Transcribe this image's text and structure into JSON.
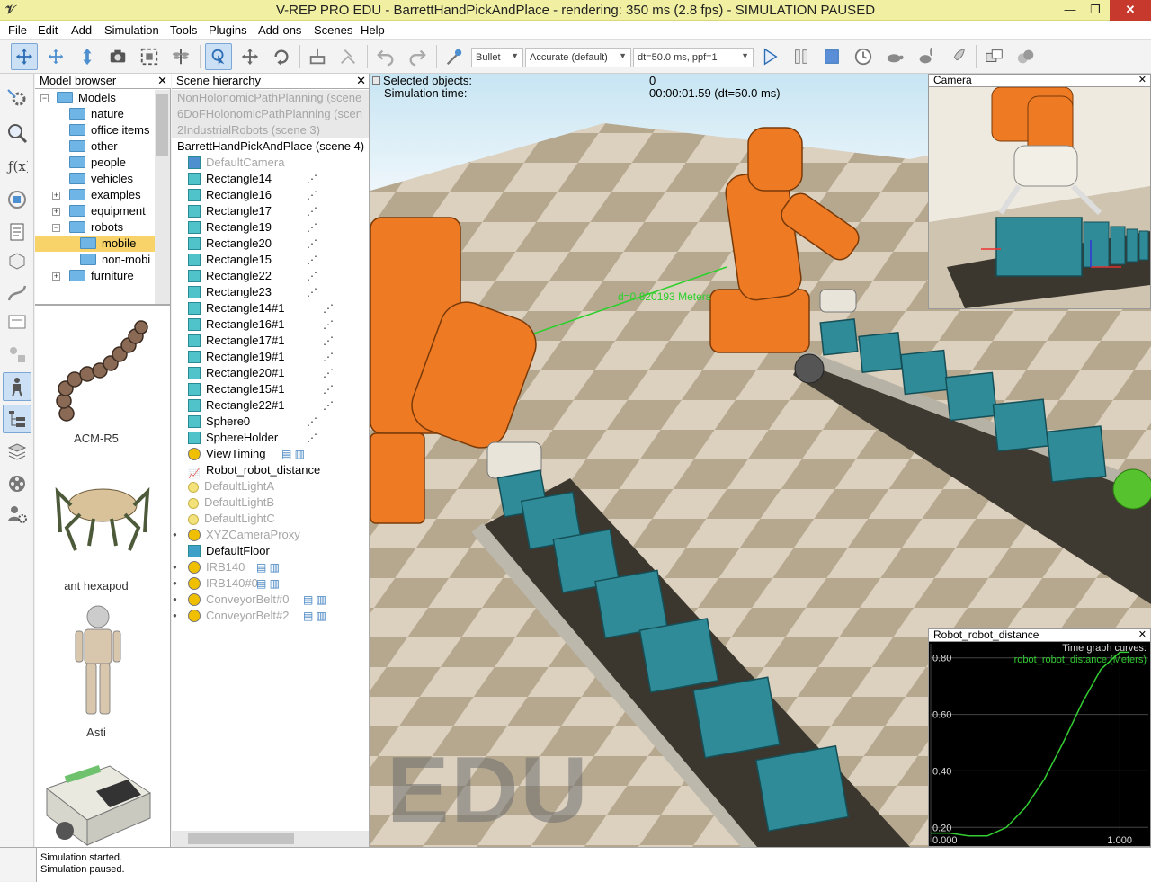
{
  "window": {
    "title": "V-REP PRO EDU - BarrettHandPickAndPlace - rendering: 350 ms (2.8 fps) - SIMULATION PAUSED",
    "controls": {
      "minimize": "—",
      "maximize": "❐",
      "close": "✕"
    }
  },
  "menu": [
    "File",
    "Edit",
    "Add",
    "Simulation",
    "Tools",
    "Plugins",
    "Add-ons",
    "Scenes",
    "Help"
  ],
  "toolbar": {
    "engine": "Bullet",
    "accuracy": "Accurate (default)",
    "timestep": "dt=50.0 ms, ppf=1"
  },
  "model_browser": {
    "title": "Model browser",
    "close": "✕",
    "root": "Models",
    "items": [
      {
        "label": "nature",
        "expandable": false
      },
      {
        "label": "office items",
        "expandable": false
      },
      {
        "label": "other",
        "expandable": false
      },
      {
        "label": "people",
        "expandable": false
      },
      {
        "label": "vehicles",
        "expandable": false
      },
      {
        "label": "examples",
        "expandable": true
      },
      {
        "label": "equipment",
        "expandable": true
      },
      {
        "label": "robots",
        "expandable": true
      },
      {
        "label": "mobile",
        "expandable": false,
        "selected": true
      },
      {
        "label": "non-mobi",
        "expandable": false
      },
      {
        "label": "furniture",
        "expandable": true
      }
    ],
    "thumbnails": [
      "ACM-R5",
      "ant hexapod",
      "Asti"
    ]
  },
  "scene_hierarchy": {
    "title": "Scene hierarchy",
    "close": "✕",
    "scenes": [
      "NonHolonomicPathPlanning (scene",
      "6DoFHolonomicPathPlanning (scen",
      "2IndustrialRobots (scene 3)"
    ],
    "current_scene": "BarrettHandPickAndPlace (scene 4)",
    "objects": [
      {
        "label": "DefaultCamera",
        "icon": "camera-icon",
        "grey": true
      },
      {
        "label": "Rectangle14",
        "icon": "cube-icon"
      },
      {
        "label": "Rectangle16",
        "icon": "cube-icon"
      },
      {
        "label": "Rectangle17",
        "icon": "cube-icon"
      },
      {
        "label": "Rectangle19",
        "icon": "cube-icon"
      },
      {
        "label": "Rectangle20",
        "icon": "cube-icon"
      },
      {
        "label": "Rectangle15",
        "icon": "cube-icon"
      },
      {
        "label": "Rectangle22",
        "icon": "cube-icon"
      },
      {
        "label": "Rectangle23",
        "icon": "cube-icon"
      },
      {
        "label": "Rectangle14#1",
        "icon": "cube-icon"
      },
      {
        "label": "Rectangle16#1",
        "icon": "cube-icon"
      },
      {
        "label": "Rectangle17#1",
        "icon": "cube-icon"
      },
      {
        "label": "Rectangle19#1",
        "icon": "cube-icon"
      },
      {
        "label": "Rectangle20#1",
        "icon": "cube-icon"
      },
      {
        "label": "Rectangle15#1",
        "icon": "cube-icon"
      },
      {
        "label": "Rectangle22#1",
        "icon": "cube-icon"
      },
      {
        "label": "Sphere0",
        "icon": "cube-icon"
      },
      {
        "label": "SphereHolder",
        "icon": "cube-icon"
      },
      {
        "label": "ViewTiming",
        "icon": "model-icon"
      },
      {
        "label": "Robot_robot_distance",
        "icon": "graph-icon"
      },
      {
        "label": "DefaultLightA",
        "icon": "light-icon",
        "grey": true
      },
      {
        "label": "DefaultLightB",
        "icon": "light-icon",
        "grey": true
      },
      {
        "label": "DefaultLightC",
        "icon": "light-icon",
        "grey": true
      },
      {
        "label": "XYZCameraProxy",
        "icon": "model-icon",
        "grey": true
      },
      {
        "label": "DefaultFloor",
        "icon": "floor-icon"
      },
      {
        "label": "IRB140",
        "icon": "model-icon",
        "grey": true
      },
      {
        "label": "IRB140#0",
        "icon": "model-icon",
        "grey": true
      },
      {
        "label": "ConveyorBelt#0",
        "icon": "model-icon",
        "grey": true
      },
      {
        "label": "ConveyorBelt#2",
        "icon": "model-icon",
        "grey": true
      }
    ]
  },
  "viewport": {
    "selected_label": "Selected objects:",
    "selected_value": "0",
    "simtime_label": "Simulation time:",
    "simtime_value": "00:00:01.59 (dt=50.0 ms)",
    "distance_label": "d=0.820193 Meters",
    "watermark": "EDU"
  },
  "camera_view": {
    "title": "Camera",
    "close": "✕"
  },
  "graph": {
    "title": "Robot_robot_distance",
    "close": "✕",
    "legend_title": "Time graph curves:",
    "series_label": "robot_robot_distance (Meters)",
    "y_ticks": [
      "0.80",
      "0.60",
      "0.40",
      "0.20"
    ],
    "x_ticks": [
      "0.000",
      "1.000"
    ],
    "line_color": "#33cc33"
  },
  "chart_data": {
    "type": "line",
    "xlim": [
      0,
      1.15
    ],
    "ylim": [
      0.15,
      0.85
    ],
    "x": [
      0.0,
      0.1,
      0.2,
      0.3,
      0.4,
      0.5,
      0.6,
      0.7,
      0.8,
      0.9,
      1.0,
      1.05
    ],
    "series": [
      {
        "name": "robot_robot_distance (Meters)",
        "values": [
          0.18,
          0.18,
          0.17,
          0.17,
          0.2,
          0.27,
          0.37,
          0.5,
          0.64,
          0.76,
          0.82,
          0.82
        ]
      }
    ]
  },
  "status": {
    "lines": [
      "Simulation started.",
      "Simulation paused."
    ]
  }
}
